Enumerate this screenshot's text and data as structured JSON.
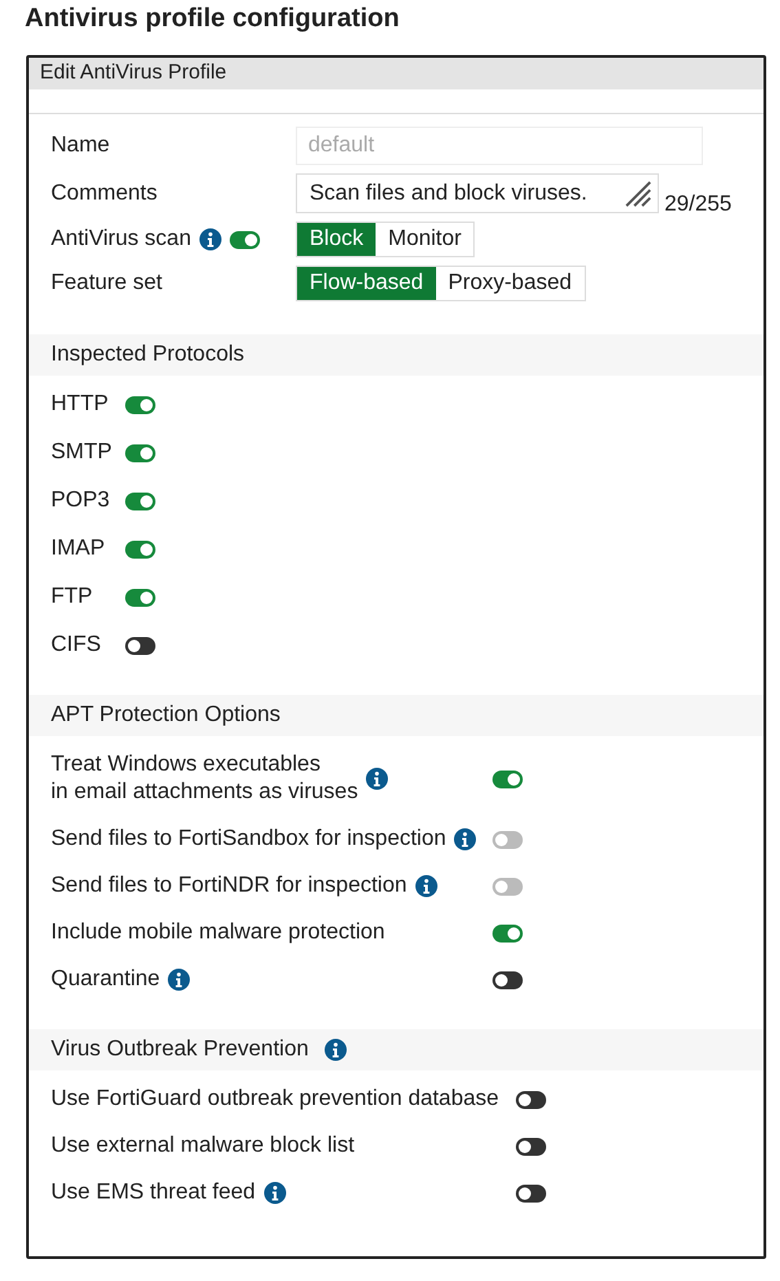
{
  "page_title": "Antivirus profile configuration",
  "panel": {
    "title": "Edit AntiVirus Profile",
    "fields": [
      {
        "kind": "text",
        "label": "Name",
        "placeholder": "default"
      },
      {
        "kind": "textarea",
        "label": "Comments",
        "value": "Scan files and block viruses.",
        "counter": "29/255"
      },
      {
        "kind": "segmented",
        "label": "AntiVirus scan",
        "info": true,
        "toggle": {
          "on": true
        },
        "options": [
          {
            "label": "Block",
            "selected": true
          },
          {
            "label": "Monitor",
            "selected": false
          }
        ]
      },
      {
        "kind": "segmented",
        "label": "Feature set",
        "options": [
          {
            "label": "Flow-based",
            "selected": true
          },
          {
            "label": "Proxy-based",
            "selected": false
          }
        ]
      }
    ],
    "sections": [
      {
        "title": "Inspected Protocols",
        "items": [
          {
            "label_lines": [
              "HTTP"
            ],
            "on": true
          },
          {
            "label_lines": [
              "SMTP"
            ],
            "on": true
          },
          {
            "label_lines": [
              "POP3"
            ],
            "on": true
          },
          {
            "label_lines": [
              "IMAP"
            ],
            "on": true
          },
          {
            "label_lines": [
              "FTP"
            ],
            "on": true
          },
          {
            "label_lines": [
              "CIFS"
            ],
            "on": false
          }
        ]
      },
      {
        "title": "APT Protection Options",
        "items": [
          {
            "label_lines": [
              "Treat Windows executables",
              "in email attachments as viruses"
            ],
            "info": true,
            "on": true
          },
          {
            "label_lines": [
              "Send files to FortiSandbox for inspection"
            ],
            "info": true,
            "on": false,
            "disabled": true
          },
          {
            "label_lines": [
              "Send files to FortiNDR for inspection"
            ],
            "info": true,
            "on": false,
            "disabled": true
          },
          {
            "label_lines": [
              "Include mobile malware protection"
            ],
            "on": true
          },
          {
            "label_lines": [
              "Quarantine"
            ],
            "info": true,
            "on": false
          }
        ]
      },
      {
        "title": "Virus Outbreak Prevention",
        "info": true,
        "items": [
          {
            "label_lines": [
              "Use FortiGuard outbreak prevention database"
            ],
            "on": false
          },
          {
            "label_lines": [
              "Use external malware block list"
            ],
            "on": false
          },
          {
            "label_lines": [
              "Use EMS threat feed"
            ],
            "info": true,
            "on": false
          }
        ]
      }
    ]
  }
}
